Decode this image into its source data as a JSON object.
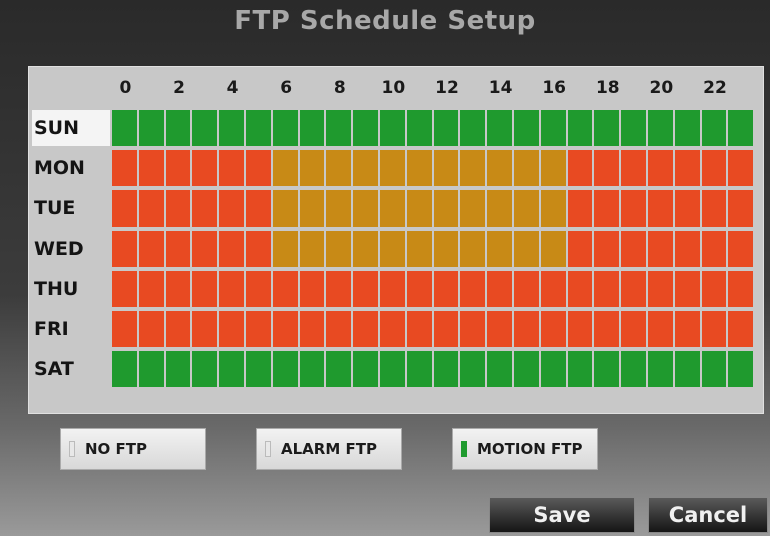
{
  "title": "FTP Schedule Setup",
  "hours": [
    "0",
    "2",
    "4",
    "6",
    "8",
    "10",
    "12",
    "14",
    "16",
    "18",
    "20",
    "22"
  ],
  "days": [
    "SUN",
    "MON",
    "TUE",
    "WED",
    "THU",
    "FRI",
    "SAT"
  ],
  "selected_day": "SUN",
  "colors": {
    "no_ftp": "#e0e0e0",
    "alarm_ftp": "#e84a22",
    "motion_ftp": "#1f9a2e",
    "both_ftp": "#c88a16"
  },
  "schedule": [
    "MMMMMMMMMMMMMMMMMMMMMMMM",
    "AAAAAABBBBBBBBBBBAAAAAAA",
    "AAAAAABBBBBBBBBBBAAAAAAA",
    "AAAAAABBBBBBBBBBBAAAAAAA",
    "AAAAAAAAAAAAAAAAAAAAAAAA",
    "AAAAAAAAAAAAAAAAAAAAAAAA",
    "MMMMMMMMMMMMMMMMMMMMMMMM"
  ],
  "legend": {
    "no_ftp": "NO FTP",
    "alarm_ftp": "ALARM FTP",
    "motion_ftp": "MOTION FTP"
  },
  "buttons": {
    "save": "Save",
    "cancel": "Cancel"
  }
}
